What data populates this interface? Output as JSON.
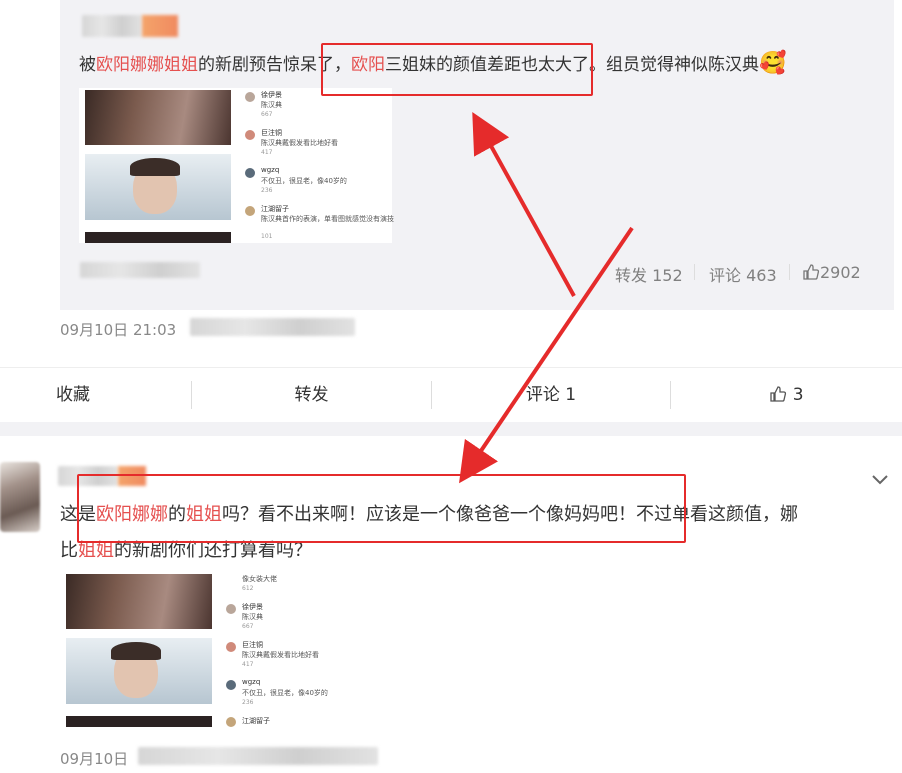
{
  "repost": {
    "text_parts": [
      "被",
      "欧阳娜娜姐姐",
      "的新剧预告惊呆了，",
      "欧阳",
      "三姐妹的颜值差距也太大了。组员觉得神似陈汉典"
    ],
    "emoji": "🥰",
    "stats": {
      "forward_label": "转发",
      "forward_count": "152",
      "comment_label": "评论",
      "comment_count": "463",
      "like_count": "2902"
    },
    "comments": [
      {
        "name": "徐伊景",
        "text": "陈汉典",
        "likes": "667"
      },
      {
        "name": "巨注铜",
        "text": "陈汉典戴假发看比地好看",
        "likes": "417"
      },
      {
        "name": "wgzq",
        "text": "不仅丑，很显老，像40岁的",
        "likes": "236"
      },
      {
        "name": "江湖留子",
        "text": "陈汉典首作的表演，单看图就感觉没有演技",
        "likes": "101"
      }
    ]
  },
  "post": {
    "timestamp": "09月10日 21:03"
  },
  "actions": {
    "collect": "收藏",
    "forward": "转发",
    "comment": "评论 1",
    "like": "3"
  },
  "reply": {
    "text_parts": [
      "这是",
      "欧阳娜娜",
      "的",
      "姐姐",
      "吗？看不出来啊！应该是一个像爸爸一个像妈妈吧！不过单看这颜值，娜"
    ],
    "line2_parts": [
      "比",
      "姐姐",
      "的新剧你们还打算看吗？"
    ],
    "timestamp": "09月10日",
    "comments": [
      {
        "name": "",
        "text": "像女装大佬",
        "likes": "612"
      },
      {
        "name": "徐伊景",
        "text": "陈汉典",
        "likes": "667"
      },
      {
        "name": "巨注铜",
        "text": "陈汉典戴假发看比地好看",
        "likes": "417"
      },
      {
        "name": "wgzq",
        "text": "不仅丑，很显老，像40岁的",
        "likes": "236"
      },
      {
        "name": "江湖留子",
        "text": "",
        "likes": ""
      }
    ]
  },
  "colors": {
    "highlight": "#e5504f",
    "annotation": "#e52b2b"
  }
}
